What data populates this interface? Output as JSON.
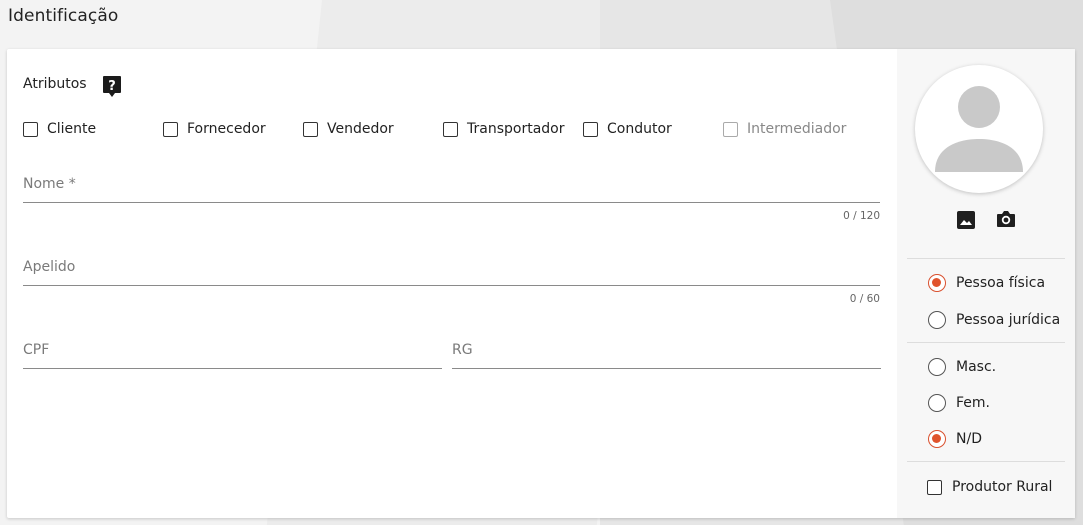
{
  "page": {
    "title": "Identificação"
  },
  "attributes": {
    "label": "Atributos",
    "help_icon": "help-question-icon",
    "items": [
      {
        "label": "Cliente",
        "checked": false,
        "disabled": false
      },
      {
        "label": "Fornecedor",
        "checked": false,
        "disabled": false
      },
      {
        "label": "Vendedor",
        "checked": false,
        "disabled": false
      },
      {
        "label": "Transportador",
        "checked": false,
        "disabled": false
      },
      {
        "label": "Condutor",
        "checked": false,
        "disabled": false
      },
      {
        "label": "Intermediador",
        "checked": false,
        "disabled": true
      }
    ]
  },
  "fields": {
    "nome": {
      "label": "Nome *",
      "value": "",
      "counter": "0 / 120"
    },
    "apelido": {
      "label": "Apelido",
      "value": "",
      "counter": "0 / 60"
    },
    "cpf": {
      "label": "CPF",
      "value": ""
    },
    "rg": {
      "label": "RG",
      "value": ""
    }
  },
  "photo": {
    "avatar_icon": "person-placeholder-icon",
    "gallery_icon": "image-icon",
    "camera_icon": "camera-icon"
  },
  "person_type": {
    "options": [
      {
        "label": "Pessoa física",
        "selected": true
      },
      {
        "label": "Pessoa jurídica",
        "selected": false
      }
    ]
  },
  "gender": {
    "options": [
      {
        "label": "Masc.",
        "selected": false
      },
      {
        "label": "Fem.",
        "selected": false
      },
      {
        "label": "N/D",
        "selected": true
      }
    ]
  },
  "rural_producer": {
    "label": "Produtor Rural",
    "checked": false
  },
  "colors": {
    "accent": "#e0532c",
    "border": "#8a8a8a",
    "muted": "#7a7a7a"
  }
}
